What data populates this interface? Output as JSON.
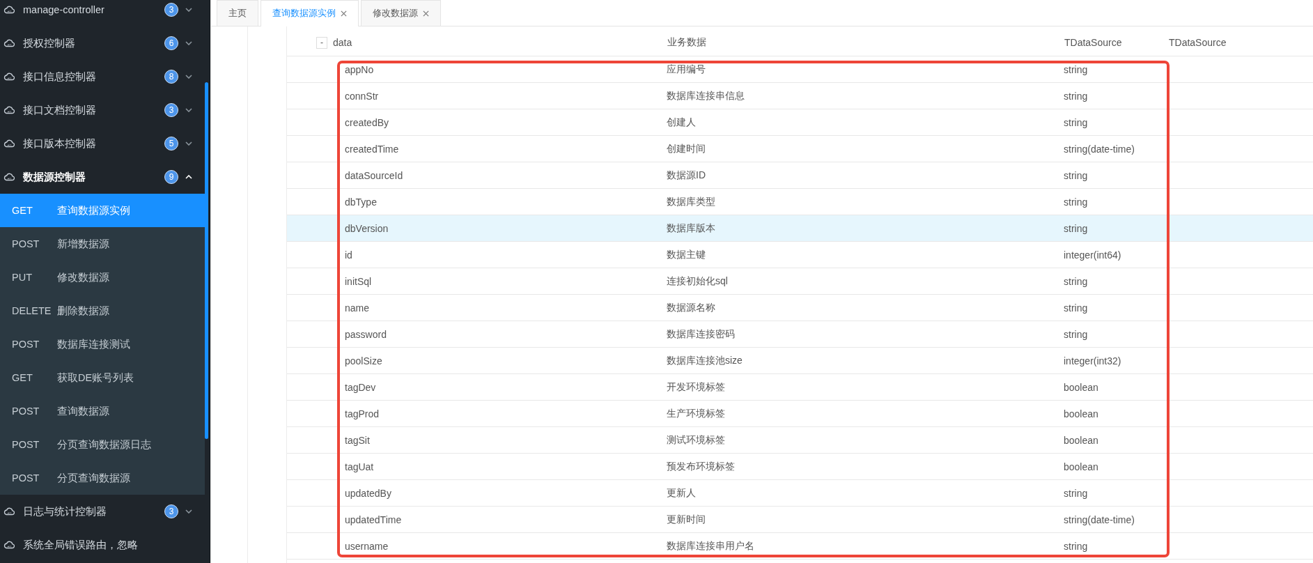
{
  "sidebar": {
    "groups": [
      {
        "label": "manage-controller",
        "count": "3",
        "expanded": false
      },
      {
        "label": "授权控制器",
        "count": "6",
        "expanded": false
      },
      {
        "label": "接口信息控制器",
        "count": "8",
        "expanded": false
      },
      {
        "label": "接口文档控制器",
        "count": "3",
        "expanded": false
      },
      {
        "label": "接口版本控制器",
        "count": "5",
        "expanded": false
      },
      {
        "label": "数据源控制器",
        "count": "9",
        "expanded": true,
        "children": [
          {
            "method": "GET",
            "label": "查询数据源实例",
            "selected": true
          },
          {
            "method": "POST",
            "label": "新增数据源",
            "selected": false
          },
          {
            "method": "PUT",
            "label": "修改数据源",
            "selected": false
          },
          {
            "method": "DELETE",
            "label": "删除数据源",
            "selected": false
          },
          {
            "method": "POST",
            "label": "数据库连接测试",
            "selected": false
          },
          {
            "method": "GET",
            "label": "获取DE账号列表",
            "selected": false
          },
          {
            "method": "POST",
            "label": "查询数据源",
            "selected": false
          },
          {
            "method": "POST",
            "label": "分页查询数据源日志",
            "selected": false
          },
          {
            "method": "POST",
            "label": "分页查询数据源",
            "selected": false
          }
        ]
      },
      {
        "label": "日志与统计控制器",
        "count": "3",
        "expanded": false
      },
      {
        "label": "系统全局错误路由，忽略"
      }
    ]
  },
  "tabs": [
    {
      "label": "主页",
      "closable": false,
      "selected": false
    },
    {
      "label": "查询数据源实例",
      "closable": true,
      "selected": true
    },
    {
      "label": "修改数据源",
      "closable": true,
      "selected": false
    }
  ],
  "table": {
    "header": {
      "toggle": "-",
      "name": "data",
      "description": "业务数据",
      "type": "TDataSource",
      "schema": "TDataSource"
    },
    "rows": [
      {
        "name": "appNo",
        "description": "应用编号",
        "type": "string",
        "selected": false
      },
      {
        "name": "connStr",
        "description": "数据库连接串信息",
        "type": "string",
        "selected": false
      },
      {
        "name": "createdBy",
        "description": "创建人",
        "type": "string",
        "selected": false
      },
      {
        "name": "createdTime",
        "description": "创建时间",
        "type": "string(date-time)",
        "selected": false
      },
      {
        "name": "dataSourceId",
        "description": "数据源ID",
        "type": "string",
        "selected": false
      },
      {
        "name": "dbType",
        "description": "数据库类型",
        "type": "string",
        "selected": false
      },
      {
        "name": "dbVersion",
        "description": "数据库版本",
        "type": "string",
        "selected": true
      },
      {
        "name": "id",
        "description": "数据主键",
        "type": "integer(int64)",
        "selected": false
      },
      {
        "name": "initSql",
        "description": "连接初始化sql",
        "type": "string",
        "selected": false
      },
      {
        "name": "name",
        "description": "数据源名称",
        "type": "string",
        "selected": false
      },
      {
        "name": "password",
        "description": "数据库连接密码",
        "type": "string",
        "selected": false
      },
      {
        "name": "poolSize",
        "description": "数据库连接池size",
        "type": "integer(int32)",
        "selected": false
      },
      {
        "name": "tagDev",
        "description": "开发环境标签",
        "type": "boolean",
        "selected": false
      },
      {
        "name": "tagProd",
        "description": "生产环境标签",
        "type": "boolean",
        "selected": false
      },
      {
        "name": "tagSit",
        "description": "测试环境标签",
        "type": "boolean",
        "selected": false
      },
      {
        "name": "tagUat",
        "description": "预发布环境标签",
        "type": "boolean",
        "selected": false
      },
      {
        "name": "updatedBy",
        "description": "更新人",
        "type": "string",
        "selected": false
      },
      {
        "name": "updatedTime",
        "description": "更新时间",
        "type": "string(date-time)",
        "selected": false
      },
      {
        "name": "username",
        "description": "数据库连接串用户名",
        "type": "string",
        "selected": false
      }
    ]
  }
}
